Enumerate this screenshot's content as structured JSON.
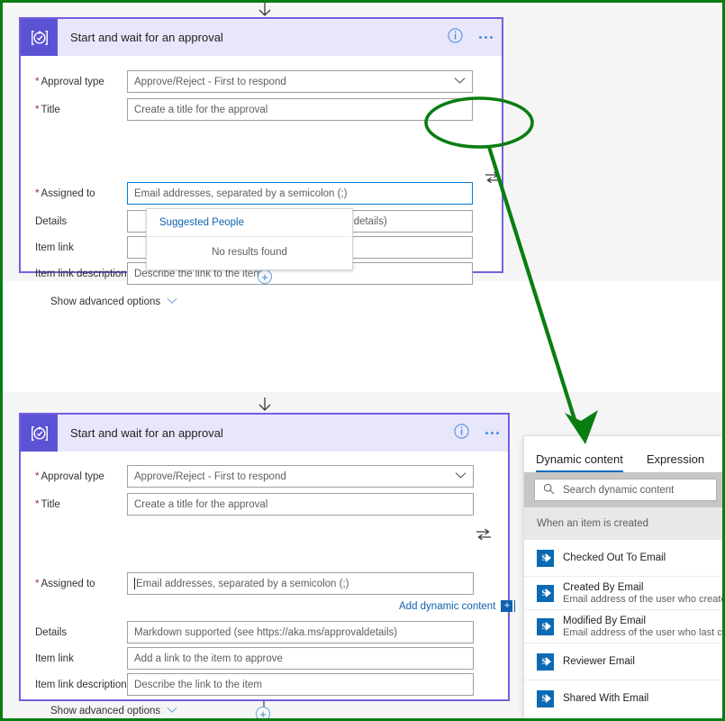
{
  "card": {
    "title": "Start and wait for an approval",
    "icon": "approval-check-icon",
    "info_icon": "info-icon",
    "more_icon": "more-options-icon",
    "swap_icon": "switch-assignee-icon",
    "advanced_label": "Show advanced options",
    "fields": [
      {
        "label": "Approval type",
        "required": true,
        "value": "Approve/Reject - First to respond",
        "dropdown": true
      },
      {
        "label": "Title",
        "required": true,
        "value": "Create a title for the approval",
        "dropdown": false
      },
      {
        "label": "Assigned to",
        "required": true,
        "value": "Email addresses, separated by a semicolon (;)",
        "dropdown": false
      },
      {
        "label": "Details",
        "required": false,
        "value": "Markdown supported (see https://aka.ms/approvaldetails)",
        "dropdown": false
      },
      {
        "label": "Item link",
        "required": false,
        "value": "Add a link to the item to approve",
        "dropdown": false
      },
      {
        "label": "Item link description",
        "required": false,
        "value": "Describe the link to the item",
        "dropdown": false
      }
    ]
  },
  "top_card": {
    "details_value_clipped": "valdetails)",
    "suggestions": {
      "header": "Suggested People",
      "empty_text": "No results found"
    }
  },
  "bottom_card": {
    "add_dynamic_content": "Add dynamic content",
    "add_dynamic_badge": "+"
  },
  "dynamic_content": {
    "tabs": [
      {
        "label": "Dynamic content",
        "active": true
      },
      {
        "label": "Expression",
        "active": false
      }
    ],
    "search_placeholder": "Search dynamic content",
    "search_icon": "search-icon",
    "group_label": "When an item is created",
    "items": [
      {
        "name": "Checked Out To Email",
        "desc": "",
        "icon": "sharepoint-icon"
      },
      {
        "name": "Created By Email",
        "desc": "Email address of the user who create",
        "icon": "sharepoint-icon"
      },
      {
        "name": "Modified By Email",
        "desc": "Email address of the user who last ch",
        "icon": "sharepoint-icon"
      },
      {
        "name": "Reviewer Email",
        "desc": "",
        "icon": "sharepoint-icon"
      },
      {
        "name": "Shared With Email",
        "desc": "",
        "icon": "sharepoint-icon"
      }
    ]
  },
  "connectors": {
    "add_step_symbol": "+",
    "down_arrow": "down-arrow-icon"
  },
  "annotations": {
    "highlight_ellipse": "green-ellipse-highlight",
    "pointer_arrow": "green-pointer-arrow",
    "color": "#0a7d12"
  },
  "colors": {
    "card_border": "#7360df",
    "card_header": "#e8e6fb",
    "icon_tile": "#5c53d4",
    "link_blue": "#0f62b0",
    "required_red": "#a4262c",
    "sharepoint_blue": "#0a6ab4",
    "annotation_green": "#0a7d12",
    "canvas_gray": "#f5f5f5"
  }
}
